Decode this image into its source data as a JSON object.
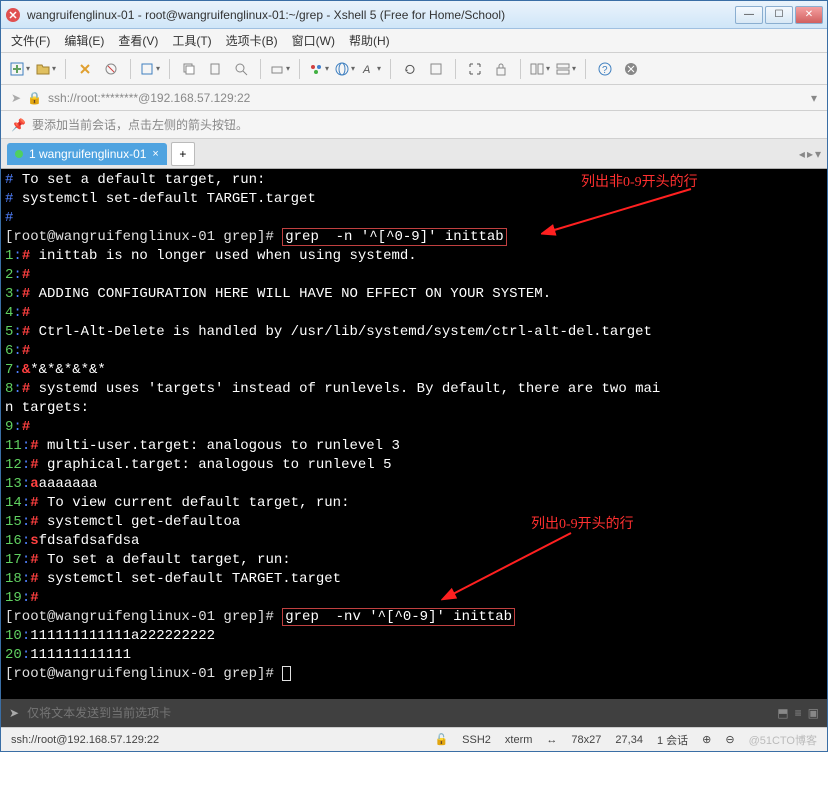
{
  "titlebar": {
    "text": "wangruifenglinux-01 - root@wangruifenglinux-01:~/grep - Xshell 5 (Free for Home/School)"
  },
  "menu": [
    "文件(F)",
    "编辑(E)",
    "查看(V)",
    "工具(T)",
    "选项卡(B)",
    "窗口(W)",
    "帮助(H)"
  ],
  "addr": "ssh://root:********@192.168.57.129:22",
  "hint": "要添加当前会话，点击左侧的箭头按钮。",
  "tab": {
    "label": "1 wangruifenglinux-01"
  },
  "annot1": "列出非0-9开头的行",
  "annot2": "列出0-9开头的行",
  "term": {
    "l1a": "# ",
    "l1b": "To set a default target, run:",
    "l2a": "# ",
    "l2b": "systemctl set-default TARGET.target",
    "l3a": "#",
    "prompt1a": "[root@wangruifenglinux-01 grep]# ",
    "cmd1": "grep  -n '^[^0-9]' inittab",
    "r1n": "1",
    "r1c": ":",
    "r1h": "#",
    "r1t": " inittab is no longer used when using systemd.",
    "r2n": "2",
    "r2c": ":",
    "r2h": "#",
    "r3n": "3",
    "r3c": ":",
    "r3h": "#",
    "r3t": " ADDING CONFIGURATION HERE WILL HAVE NO EFFECT ON YOUR SYSTEM.",
    "r4n": "4",
    "r4c": ":",
    "r4h": "#",
    "r5n": "5",
    "r5c": ":",
    "r5h": "#",
    "r5t": " Ctrl-Alt-Delete is handled by /usr/lib/systemd/system/ctrl-alt-del.target",
    "r6n": "6",
    "r6c": ":",
    "r6h": "#",
    "r7n": "7",
    "r7c": ":",
    "r7h": "&",
    "r7t": "*&*&*&*&*",
    "r8n": "8",
    "r8c": ":",
    "r8h": "#",
    "r8t": " systemd uses 'targets' instead of runlevels. By default, there are two mai",
    "r8w": "n targets:",
    "r9n": "9",
    "r9c": ":",
    "r9h": "#",
    "r11n": "11",
    "r11c": ":",
    "r11h": "#",
    "r11t": " multi-user.target: analogous to runlevel 3",
    "r12n": "12",
    "r12c": ":",
    "r12h": "#",
    "r12t": " graphical.target: analogous to runlevel 5",
    "r13n": "13",
    "r13c": ":",
    "r13h": "a",
    "r13t": "aaaaaaa",
    "r14n": "14",
    "r14c": ":",
    "r14h": "#",
    "r14t": " To view current default target, run:",
    "r15n": "15",
    "r15c": ":",
    "r15h": "#",
    "r15t": " systemctl get-defaultoa",
    "r16n": "16",
    "r16c": ":",
    "r16h": "s",
    "r16t": "fdsafdsafdsa",
    "r17n": "17",
    "r17c": ":",
    "r17h": "#",
    "r17t": " To set a default target, run:",
    "r18n": "18",
    "r18c": ":",
    "r18h": "#",
    "r18t": " systemctl set-default TARGET.target",
    "r19n": "19",
    "r19c": ":",
    "r19h": "#",
    "prompt2a": "[root@wangruifenglinux-01 grep]# ",
    "cmd2": "grep  -nv '^[^0-9]' inittab",
    "v10n": "10",
    "v10c": ":",
    "v10t": "111111111111a222222222",
    "v20n": "20",
    "v20c": ":",
    "v20t": "111111111111",
    "prompt3": "[root@wangruifenglinux-01 grep]# "
  },
  "inputbar": {
    "placeholder": "仅将文本发送到当前选项卡"
  },
  "status": {
    "left": "ssh://root@192.168.57.129:22",
    "s1": "SSH2",
    "s2": "xterm",
    "s3": "78x27",
    "s4": "27,34",
    "s5": "1 会话",
    "wm": "@51CTO博客"
  }
}
